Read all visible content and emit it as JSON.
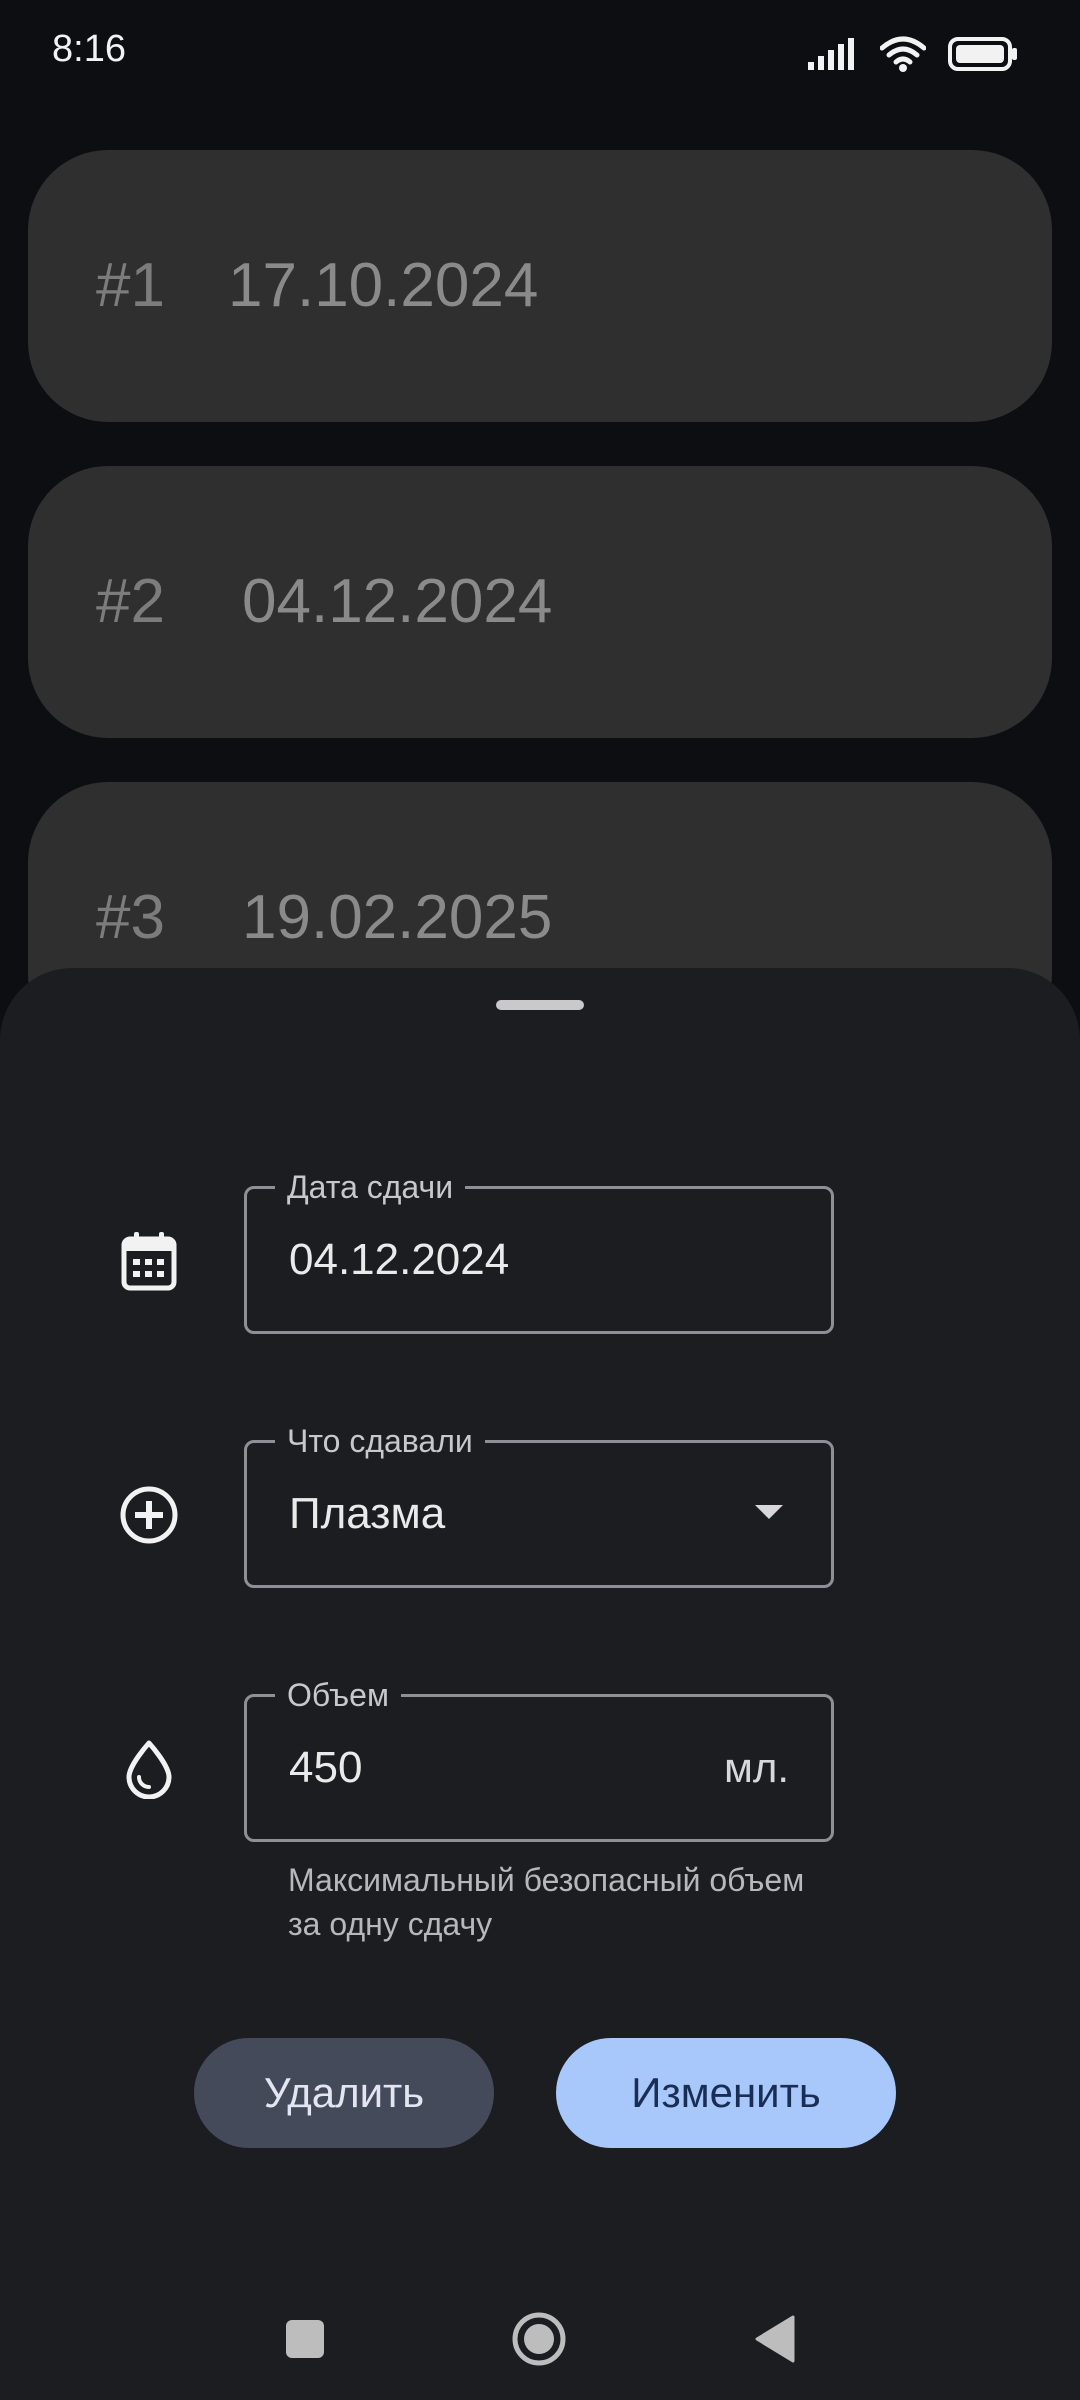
{
  "status_bar": {
    "time": "8:16",
    "icons": [
      "signal-icon",
      "wifi-icon",
      "battery-icon"
    ]
  },
  "records": [
    {
      "index": "#1",
      "date": "17.10.2024"
    },
    {
      "index": "#2",
      "date": "04.12.2024"
    },
    {
      "index": "#3",
      "date": "19.02.2025"
    }
  ],
  "sheet": {
    "date_field": {
      "label": "Дата сдачи",
      "value": "04.12.2024",
      "icon": "calendar-icon"
    },
    "type_field": {
      "label": "Что сдавали",
      "value": "Плазма",
      "icon": "add-circle-icon"
    },
    "volume_field": {
      "label": "Объем",
      "value": "450",
      "suffix": "мл.",
      "icon": "drop-icon",
      "helper": "Максимальный безопасный объем за одну сдачу"
    },
    "buttons": {
      "delete": "Удалить",
      "edit": "Изменить"
    }
  },
  "colors": {
    "background": "#0d0e12",
    "card": "#2f2f2f",
    "sheet": "#1c1d21",
    "primary_button": "#a8c7fa",
    "secondary_button": "#454a5b"
  },
  "navigation": [
    "recents-square-icon",
    "home-circle-icon",
    "back-triangle-icon"
  ]
}
